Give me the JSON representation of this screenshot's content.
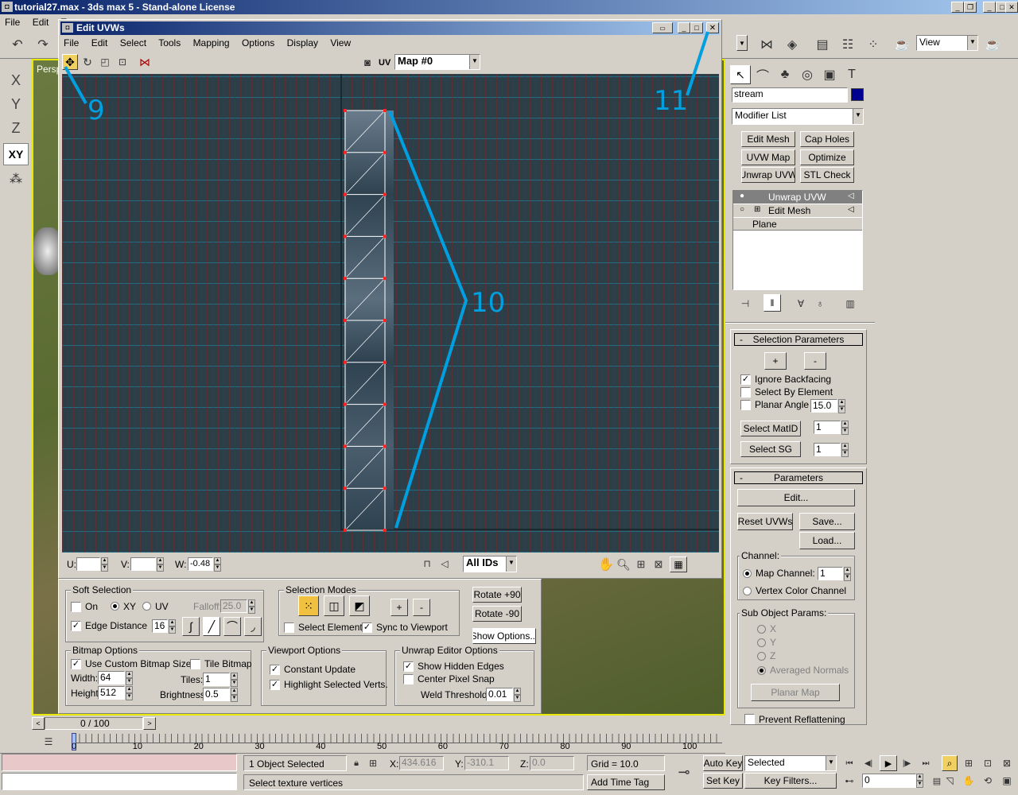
{
  "app": {
    "title": "tutorial27.max - 3ds max 5 - Stand-alone License",
    "menu": [
      "File",
      "Edit",
      "T"
    ]
  },
  "viewport_label": "Persp",
  "axis_buttons": [
    "X",
    "Y",
    "Z",
    "XY"
  ],
  "main_toolbar": {
    "view_dropdown": "View"
  },
  "uvw_window": {
    "title": "Edit UVWs",
    "menu": [
      "File",
      "Edit",
      "Select",
      "Tools",
      "Mapping",
      "Options",
      "Display",
      "View"
    ],
    "uv_label": "UV",
    "map_dropdown": "Map #0",
    "u_label": "U:",
    "v_label": "V:",
    "w_label": "W:",
    "w_value": "-0.48",
    "ids_dropdown": "All IDs"
  },
  "annotations": {
    "a9": "9",
    "a10": "10",
    "a11": "11"
  },
  "uv_vertices_y": [
    0,
    1,
    2,
    3,
    4,
    5,
    6,
    7,
    8,
    9,
    10
  ],
  "soft_selection": {
    "title": "Soft Selection",
    "on_label": "On",
    "xy_label": "XY",
    "uv_label": "UV",
    "falloff_label": "Falloff:",
    "falloff_value": "25.0",
    "edge_distance_label": "Edge Distance",
    "edge_value": "16"
  },
  "selection_modes": {
    "title": "Selection Modes",
    "plus": "+",
    "minus": "-",
    "select_element": "Select Element",
    "sync": "Sync to Viewport"
  },
  "rotate": {
    "plus90": "Rotate +90",
    "minus90": "Rotate -90",
    "show_options": "Show Options..."
  },
  "bitmap_options": {
    "title": "Bitmap Options",
    "custom_size": "Use Custom Bitmap Size",
    "tile": "Tile Bitmap",
    "width_label": "Width:",
    "width": "64",
    "height_label": "Height:",
    "height": "512",
    "tiles_label": "Tiles:",
    "tiles": "1",
    "brightness_label": "Brightness:",
    "brightness": "0.5"
  },
  "viewport_options": {
    "title": "Viewport Options",
    "constant": "Constant Update",
    "highlight": "Highlight Selected Verts."
  },
  "editor_options": {
    "title": "Unwrap Editor Options",
    "hidden": "Show Hidden Edges",
    "center": "Center Pixel Snap",
    "weld_label": "Weld Threshold:",
    "weld": "0.01"
  },
  "command_panel": {
    "name": "stream",
    "modifier_list": "Modifier List",
    "mod_buttons": [
      "Edit Mesh",
      "Cap Holes",
      "UVW Map",
      "Optimize",
      "Unwrap UVW",
      "STL Check"
    ],
    "stack": [
      "Unwrap UVW",
      "Edit Mesh",
      "Plane"
    ],
    "selection_params": {
      "title": "Selection Parameters",
      "plus": "+",
      "minus": "-",
      "ignore": "Ignore Backfacing",
      "by_element": "Select By Element",
      "planar": "Planar Angle",
      "planar_value": "15.0",
      "matid_btn": "Select MatID",
      "matid": "1",
      "sg_btn": "Select SG",
      "sg": "1"
    },
    "parameters": {
      "title": "Parameters",
      "edit": "Edit...",
      "reset": "Reset UVWs",
      "save": "Save...",
      "load": "Load...",
      "channel_label": "Channel:",
      "map_channel": "Map Channel:",
      "map_channel_value": "1",
      "vertex_color": "Vertex Color Channel",
      "sub_object": "Sub Object Params:",
      "x": "X",
      "y": "Y",
      "z": "Z",
      "avg": "Averaged Normals",
      "planar_map": "Planar Map",
      "prevent": "Prevent Reflattening"
    }
  },
  "timeline": {
    "frame": "0 / 100",
    "ticks": [
      "0",
      "10",
      "20",
      "30",
      "40",
      "50",
      "60",
      "70",
      "80",
      "90",
      "100"
    ]
  },
  "status": {
    "objects": "1 Object Selected",
    "prompt": "Select texture vertices",
    "x_label": "X:",
    "x": "434.616",
    "y_label": "Y:",
    "y": "-310.1",
    "z_label": "Z:",
    "z": "0.0",
    "grid": "Grid = 10.0",
    "add_time_tag": "Add Time Tag",
    "auto_key": "Auto Key",
    "set_key": "Set Key",
    "selected": "Selected",
    "key_filters": "Key Filters...",
    "frame_field": "0"
  }
}
